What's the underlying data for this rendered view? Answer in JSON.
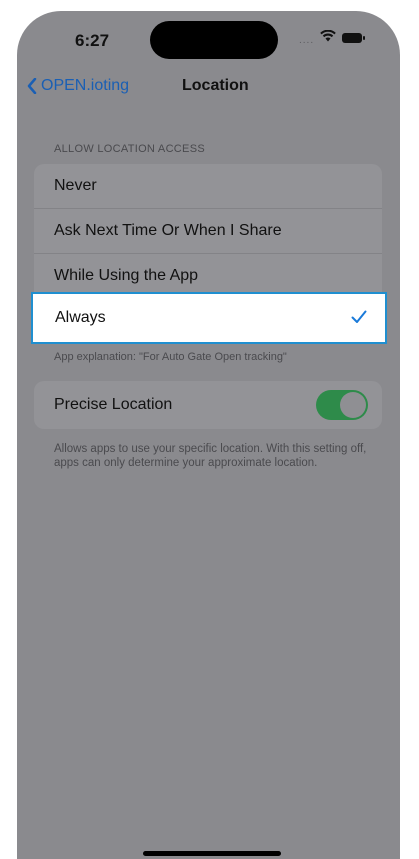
{
  "status": {
    "time": "6:27",
    "signal": "....",
    "wifi_icon": "wifi-icon",
    "battery_icon": "battery-icon"
  },
  "nav": {
    "back_label": "OPEN.ioting",
    "title": "Location"
  },
  "location_access": {
    "header": "ALLOW LOCATION ACCESS",
    "options": [
      {
        "label": "Never"
      },
      {
        "label": "Ask Next Time Or When I Share"
      },
      {
        "label": "While Using the App"
      },
      {
        "label": "Always"
      }
    ],
    "selected": "Always",
    "footer": "App explanation: \"For Auto Gate Open tracking\""
  },
  "precise_location": {
    "label": "Precise Location",
    "enabled": true,
    "description": "Allows apps to use your specific location. With this setting off, apps can only determine your approximate location."
  },
  "colors": {
    "accent": "#1a7ad9",
    "toggle_on": "#2e8b4a",
    "highlight_border": "#1f8fd0"
  }
}
